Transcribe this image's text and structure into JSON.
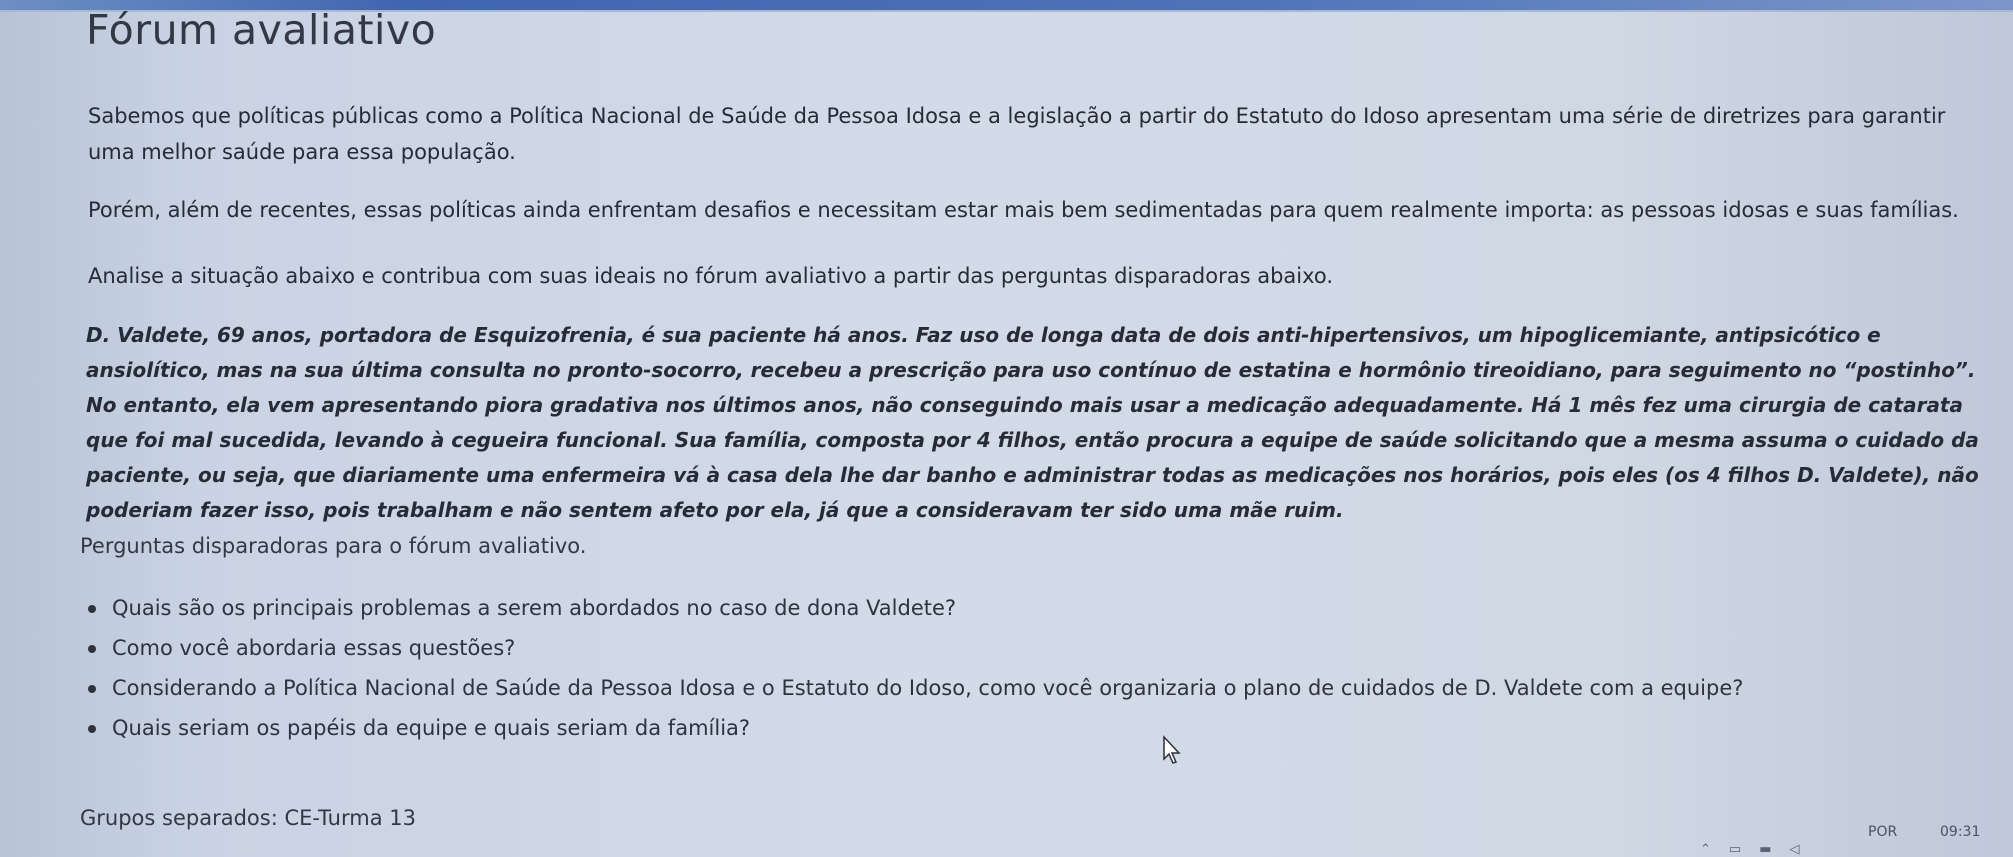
{
  "page": {
    "title": "Fórum avaliativo"
  },
  "intro": {
    "paragraph1": "Sabemos que políticas públicas como a Política Nacional de Saúde da Pessoa Idosa e a legislação a partir do Estatuto do Idoso apresentam uma série de diretrizes para garantir uma melhor saúde para essa população.",
    "paragraph2": "Porém, além de recentes, essas políticas ainda enfrentam desafios e necessitam estar mais bem sedimentadas para quem realmente importa: as pessoas idosas e suas famílias.",
    "paragraph3": "Analise a situação abaixo e contribua com suas ideais no fórum avaliativo a partir das perguntas disparadoras abaixo."
  },
  "case": {
    "text": "D. Valdete, 69 anos, portadora de Esquizofrenia, é sua paciente há anos. Faz uso de longa data de dois anti-hipertensivos, um hipoglicemiante, antipsicótico e ansiolítico, mas na sua última consulta no pronto-socorro, recebeu a prescrição para uso contínuo de estatina e hormônio tireoidiano, para seguimento no “postinho”. No entanto, ela vem apresentando piora gradativa nos últimos anos, não conseguindo mais usar a medicação adequadamente. Há 1 mês fez uma cirurgia de catarata que foi mal sucedida, levando à cegueira funcional. Sua família, composta por 4 filhos, então procura a equipe de saúde solicitando que a mesma assuma o cuidado da paciente, ou seja, que diariamente uma enfermeira vá à casa dela lhe dar banho e administrar todas as medicações nos horários, pois eles (os 4 filhos D. Valdete), não poderiam fazer isso, pois trabalham e não sentem afeto por ela, já que a consideravam ter sido uma mãe ruim."
  },
  "questions": {
    "heading": "Perguntas disparadoras para o fórum avaliativo.",
    "items": [
      "Quais são os principais problemas a serem abordados no caso de dona Valdete?",
      "Como você abordaria essas questões?",
      "Considerando a Política Nacional de Saúde da Pessoa Idosa e o Estatuto do Idoso, como você organizaria o plano de cuidados de D. Valdete com a equipe?",
      "Quais seriam os papéis da equipe e quais seriam da família?"
    ]
  },
  "groups": {
    "label": "Grupos separados: CE-Turma 13"
  },
  "taskbar": {
    "language": "POR",
    "time": "09:31"
  },
  "colors": {
    "background": "#d0d8e4",
    "text": "#262b35",
    "top_strip": "#3f66b0"
  }
}
